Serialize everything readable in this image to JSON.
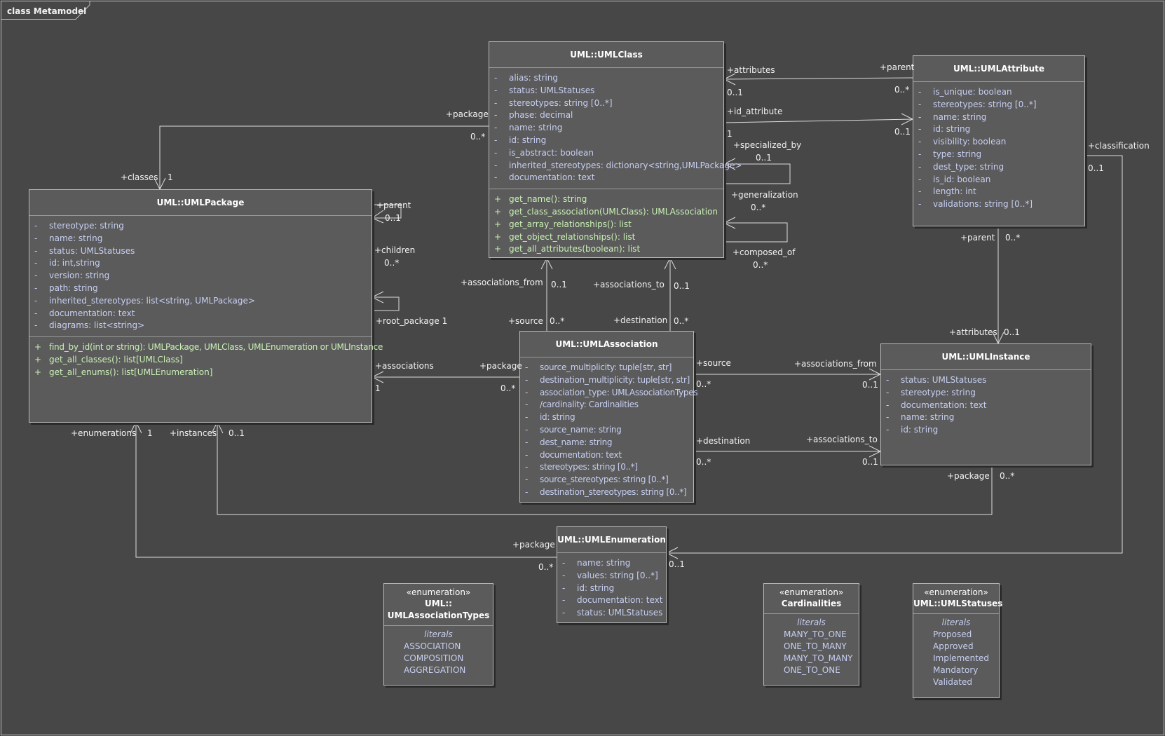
{
  "frame": {
    "title": "class Metamodel"
  },
  "classes": {
    "umlclass": {
      "name": "UML::UMLClass",
      "attributes": [
        {
          "v": "-",
          "t": "alias: string"
        },
        {
          "v": "-",
          "t": "status: UMLStatuses"
        },
        {
          "v": "-",
          "t": "stereotypes: string [0..*]"
        },
        {
          "v": "-",
          "t": "phase: decimal"
        },
        {
          "v": "-",
          "t": "name: string"
        },
        {
          "v": "-",
          "t": "id: string"
        },
        {
          "v": "-",
          "t": "is_abstract: boolean"
        },
        {
          "v": "-",
          "t": "inherited_stereotypes: dictionary<string,UMLPackage>"
        },
        {
          "v": "-",
          "t": "documentation: text"
        }
      ],
      "operations": [
        {
          "v": "+",
          "t": "get_name(): string"
        },
        {
          "v": "+",
          "t": "get_class_association(UMLClass): UMLAssociation"
        },
        {
          "v": "+",
          "t": "get_array_relationships(): list"
        },
        {
          "v": "+",
          "t": "get_object_relationships(): list"
        },
        {
          "v": "+",
          "t": "get_all_attributes(boolean): list"
        }
      ]
    },
    "umlattribute": {
      "name": "UML::UMLAttribute",
      "attributes": [
        {
          "v": "-",
          "t": "is_unique: boolean"
        },
        {
          "v": "-",
          "t": "stereotypes: string [0..*]"
        },
        {
          "v": "-",
          "t": "name: string"
        },
        {
          "v": "-",
          "t": "id: string"
        },
        {
          "v": "-",
          "t": "visibility: boolean"
        },
        {
          "v": "-",
          "t": "type: string"
        },
        {
          "v": "-",
          "t": "dest_type: string"
        },
        {
          "v": "-",
          "t": "is_id: boolean"
        },
        {
          "v": "-",
          "t": "length: int"
        },
        {
          "v": "-",
          "t": "validations: string [0..*]"
        }
      ]
    },
    "umlpackage": {
      "name": "UML::UMLPackage",
      "attributes": [
        {
          "v": "-",
          "t": "stereotype: string"
        },
        {
          "v": "-",
          "t": "name: string"
        },
        {
          "v": "-",
          "t": "status: UMLStatuses"
        },
        {
          "v": "-",
          "t": "id: int,string"
        },
        {
          "v": "-",
          "t": "version: string"
        },
        {
          "v": "-",
          "t": "path: string"
        },
        {
          "v": "-",
          "t": "inherited_stereotypes: list<string, UMLPackage>"
        },
        {
          "v": "-",
          "t": "documentation: text"
        },
        {
          "v": "-",
          "t": "diagrams: list<string>"
        }
      ],
      "operations": [
        {
          "v": "+",
          "t": "find_by_id(int or string): UMLPackage, UMLClass, UMLEnumeration or UMLInstance"
        },
        {
          "v": "+",
          "t": "get_all_classes(): list[UMLClass]"
        },
        {
          "v": "+",
          "t": "get_all_enums(): list[UMLEnumeration]"
        }
      ]
    },
    "umlassociation": {
      "name": "UML::UMLAssociation",
      "attributes": [
        {
          "v": "-",
          "t": "source_multiplicity: tuple[str, str]"
        },
        {
          "v": "-",
          "t": "destination_multiplicity: tuple[str, str]"
        },
        {
          "v": "-",
          "t": "association_type: UMLAssociationTypes"
        },
        {
          "v": "-",
          "t": "/cardinality: Cardinalities"
        },
        {
          "v": "-",
          "t": "id: string"
        },
        {
          "v": "-",
          "t": "source_name: string"
        },
        {
          "v": "-",
          "t": "dest_name: string"
        },
        {
          "v": "-",
          "t": "documentation: text"
        },
        {
          "v": "-",
          "t": "stereotypes: string [0..*]"
        },
        {
          "v": "-",
          "t": "source_stereotypes: string [0..*]"
        },
        {
          "v": "-",
          "t": "destination_stereotypes: string [0..*]"
        }
      ]
    },
    "umlinstance": {
      "name": "UML::UMLInstance",
      "attributes": [
        {
          "v": "-",
          "t": "status: UMLStatuses"
        },
        {
          "v": "-",
          "t": "stereotype: string"
        },
        {
          "v": "-",
          "t": "documentation: text"
        },
        {
          "v": "-",
          "t": "name: string"
        },
        {
          "v": "-",
          "t": "id: string"
        }
      ]
    },
    "umlenumeration": {
      "name": "UML::UMLEnumeration",
      "attributes": [
        {
          "v": "-",
          "t": "name: string"
        },
        {
          "v": "-",
          "t": "values: string [0..*]"
        },
        {
          "v": "-",
          "t": "id: string"
        },
        {
          "v": "-",
          "t": "documentation: text"
        },
        {
          "v": "-",
          "t": "status: UMLStatuses"
        }
      ]
    }
  },
  "enums": {
    "assoc_types": {
      "stereotype": "«enumeration»",
      "name_line1": "UML::",
      "name_line2": "UMLAssociationTypes",
      "literals_title": "literals",
      "literals": [
        "ASSOCIATION",
        "COMPOSITION",
        "AGGREGATION"
      ]
    },
    "cardinalities": {
      "stereotype": "«enumeration»",
      "name_line1": "Cardinalities",
      "literals_title": "literals",
      "literals": [
        "MANY_TO_ONE",
        "ONE_TO_MANY",
        "MANY_TO_MANY",
        "ONE_TO_ONE"
      ]
    },
    "statuses": {
      "stereotype": "«enumeration»",
      "name_line1": "UML::UMLStatuses",
      "literals_title": "literals",
      "literals": [
        "Proposed",
        "Approved",
        "Implemented",
        "Mandatory",
        "Validated"
      ]
    }
  },
  "labels": {
    "attributes_role": "+attributes",
    "attr_mult_class": "0..1",
    "parent_role_attr": "+parent",
    "parent_mult_attr": "0..*",
    "id_attribute_role": "+id_attribute",
    "id_attr_mult_class": "1",
    "id_attr_mult_attr": "0..1",
    "package_role_class": "+package",
    "package_mult_class": "0..*",
    "classes_role": "+classes",
    "classes_mult": "1",
    "specialized_by_role": "+specialized_by",
    "specialized_by_mult": "0..1",
    "generalization_role": "+generalization",
    "generalization_mult": "0..*",
    "composed_of_role": "+composed_of",
    "composed_of_mult": "0..*",
    "classification_role": "+classification",
    "classification_mult": "0..1",
    "parent_role_inst": "+parent",
    "parent_mult_inst": "0..*",
    "attributes_role_inst": "+attributes",
    "attributes_mult_inst": "0..1",
    "pkg_parent_role": "+parent",
    "pkg_parent_mult": "0..1",
    "pkg_children_role": "+children",
    "pkg_children_mult": "0..*",
    "root_package_role": "+root_package 1",
    "assoc_from_role": "+associations_from",
    "assoc_from_mult": "0..1",
    "source_role": "+source",
    "source_mult": "0..*",
    "assoc_to_role": "+associations_to",
    "assoc_to_mult": "0..1",
    "destination_role": "+destination",
    "destination_mult": "0..*",
    "associations_role": "+associations",
    "associations_mult": "1",
    "package_role_assoc": "+package",
    "package_mult_assoc": "0..*",
    "inst_source_role": "+source",
    "inst_source_mult": "0..*",
    "inst_assoc_from_role": "+associations_from",
    "inst_assoc_from_mult": "0..1",
    "inst_destination_role": "+destination",
    "inst_destination_mult": "0..*",
    "inst_assoc_to_role": "+associations_to",
    "inst_assoc_to_mult": "0..1",
    "enumerations_role": "+enumerations",
    "enumerations_mult": "1",
    "instances_role": "+instances",
    "instances_mult": "0..1",
    "inst_package_role": "+package",
    "inst_package_mult": "0..*",
    "enum_package_role": "+package",
    "enum_package_mult": "0..*",
    "enum_class_mult": "0..1"
  }
}
